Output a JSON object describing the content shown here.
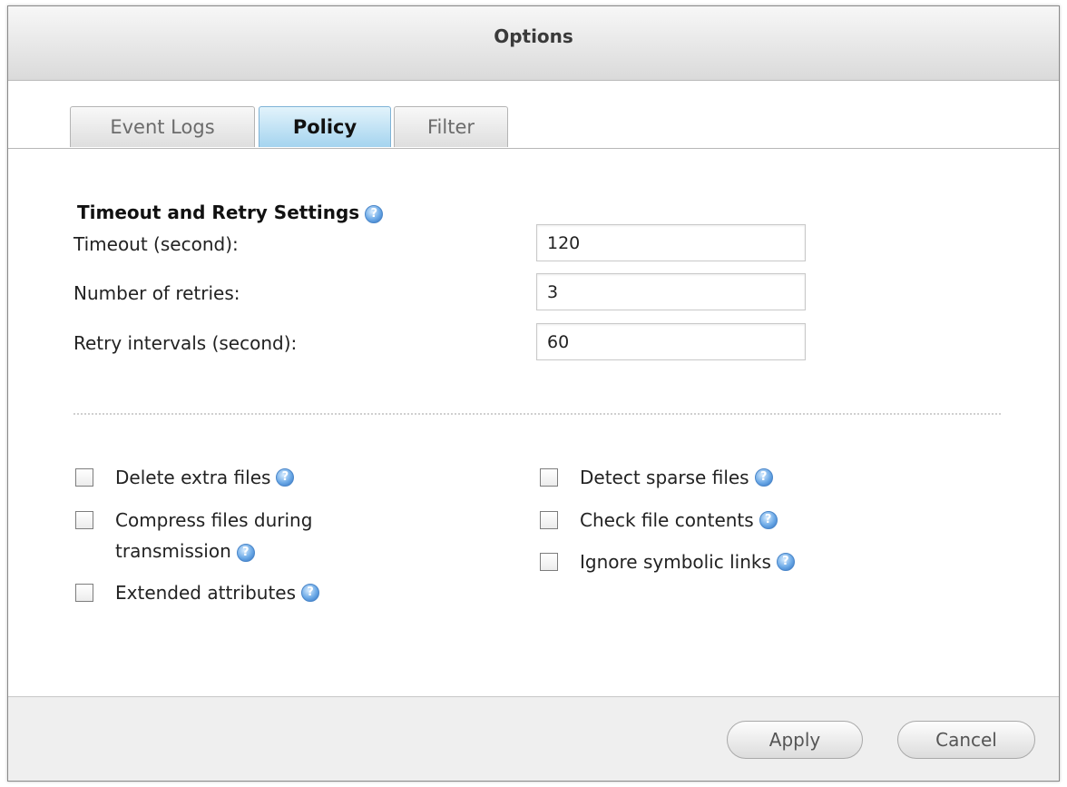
{
  "dialog": {
    "title": "Options"
  },
  "tabs": [
    {
      "label": "Event Logs",
      "active": false
    },
    {
      "label": "Policy",
      "active": true
    },
    {
      "label": "Filter",
      "active": false
    }
  ],
  "timeout_section": {
    "title": "Timeout and Retry Settings",
    "rows": [
      {
        "label": "Timeout (second):",
        "value": "120"
      },
      {
        "label": "Number of retries:",
        "value": "3"
      },
      {
        "label": "Retry intervals (second):",
        "value": "60"
      }
    ]
  },
  "options": {
    "left": [
      {
        "label": "Delete extra files",
        "checked": false
      },
      {
        "label_line1": "Compress files during",
        "label_line2": "transmission",
        "checked": false
      },
      {
        "label": "Extended attributes",
        "checked": false
      }
    ],
    "right": [
      {
        "label": "Detect sparse files",
        "checked": false
      },
      {
        "label": "Check file contents",
        "checked": false
      },
      {
        "label": "Ignore symbolic links",
        "checked": false
      }
    ]
  },
  "footer": {
    "apply_label": "Apply",
    "cancel_label": "Cancel"
  },
  "colors": {
    "active_tab": "#a5d4ef",
    "help_icon": "#4a86c9"
  },
  "icons": {
    "help": "help-icon",
    "checkbox": "checkbox-icon"
  }
}
